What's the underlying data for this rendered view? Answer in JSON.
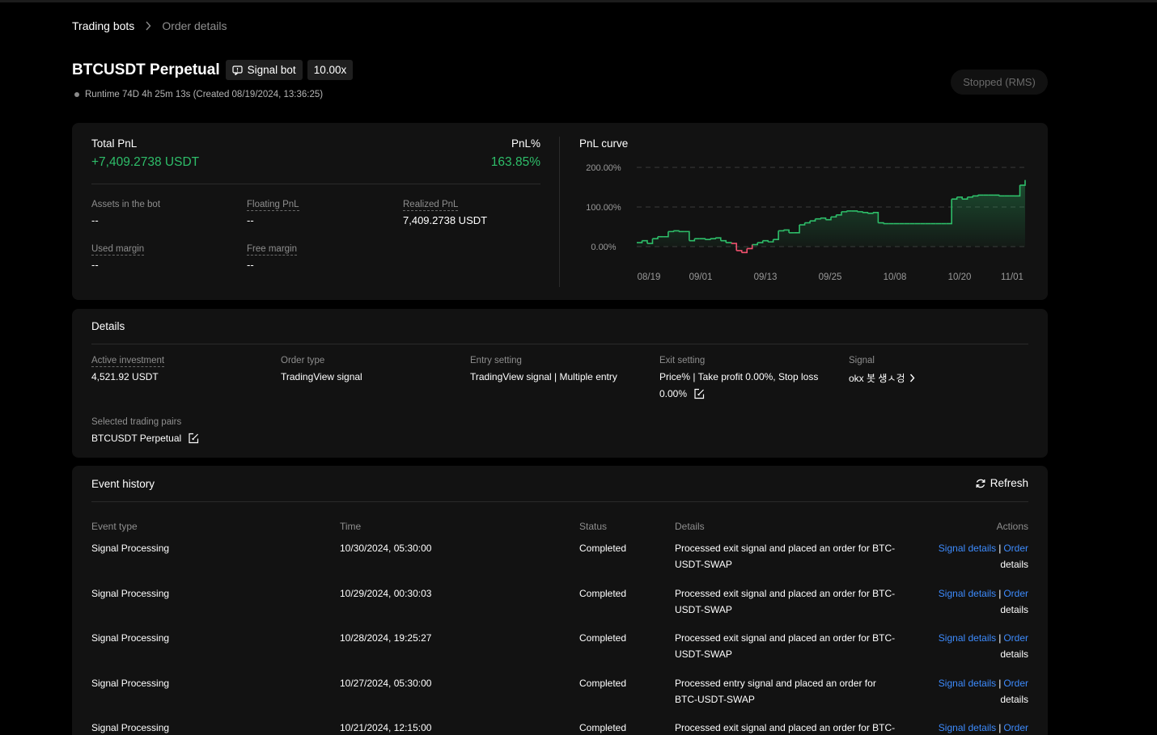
{
  "breadcrumb": {
    "root": "Trading bots",
    "current": "Order details"
  },
  "header": {
    "title": "BTCUSDT Perpetual",
    "bot_type": "Signal bot",
    "leverage": "10.00x",
    "runtime": "Runtime 74D 4h 25m 13s (Created 08/19/2024, 13:36:25)",
    "status": "Stopped (RMS)"
  },
  "summary": {
    "total_pnl_label": "Total PnL",
    "total_pnl_value": "+7,409.2738 USDT",
    "pnl_pct_label": "PnL%",
    "pnl_pct_value": "163.85%",
    "assets_label": "Assets in the bot",
    "assets_value": "--",
    "floating_label": "Floating PnL",
    "floating_value": "--",
    "realized_label": "Realized PnL",
    "realized_value": "7,409.2738 USDT",
    "used_margin_label": "Used margin",
    "used_margin_value": "--",
    "free_margin_label": "Free margin",
    "free_margin_value": "--"
  },
  "chart_data": {
    "type": "area",
    "title": "PnL curve",
    "xlabel": "",
    "ylabel": "",
    "yticks": [
      "200.00%",
      "100.00%",
      "0.00%"
    ],
    "xticks": [
      "08/19",
      "09/01",
      "09/13",
      "09/25",
      "10/08",
      "10/20",
      "11/01"
    ],
    "ylim": [
      0,
      200
    ],
    "grid": true,
    "colors": {
      "positive": "#2ebd69",
      "negative": "#f0506e"
    },
    "x": [
      "08/19",
      "08/20",
      "08/21",
      "08/22",
      "08/23",
      "08/24",
      "08/25",
      "08/26",
      "08/27",
      "08/28",
      "08/29",
      "08/30",
      "08/31",
      "09/01",
      "09/02",
      "09/03",
      "09/04",
      "09/05",
      "09/06",
      "09/07",
      "09/08",
      "09/09",
      "09/10",
      "09/11",
      "09/12",
      "09/13",
      "09/14",
      "09/15",
      "09/16",
      "09/17",
      "09/18",
      "09/19",
      "09/20",
      "09/21",
      "09/22",
      "09/23",
      "09/24",
      "09/25",
      "09/26",
      "09/27",
      "09/28",
      "09/29",
      "09/30",
      "10/01",
      "10/02",
      "10/03",
      "10/04",
      "10/05",
      "10/06",
      "10/07",
      "10/08",
      "10/09",
      "10/10",
      "10/11",
      "10/12",
      "10/13",
      "10/14",
      "10/15",
      "10/16",
      "10/17",
      "10/18",
      "10/19",
      "10/20",
      "10/21",
      "10/22",
      "10/23",
      "10/24",
      "10/25",
      "10/26",
      "10/27",
      "10/28",
      "10/29",
      "10/30",
      "10/31",
      "11/01"
    ],
    "values": [
      10,
      15,
      8,
      20,
      25,
      25,
      38,
      40,
      38,
      38,
      15,
      20,
      20,
      18,
      20,
      22,
      15,
      10,
      8,
      -10,
      -15,
      -5,
      5,
      10,
      15,
      12,
      18,
      40,
      42,
      35,
      35,
      55,
      60,
      65,
      70,
      72,
      68,
      75,
      80,
      88,
      90,
      90,
      88,
      86,
      84,
      86,
      60,
      58,
      58,
      58,
      58,
      58,
      58,
      58,
      58,
      58,
      58,
      58,
      58,
      58,
      120,
      125,
      120,
      125,
      128,
      130,
      130,
      130,
      130,
      128,
      128,
      128,
      128,
      155,
      168
    ]
  },
  "details": {
    "heading": "Details",
    "active_investment_label": "Active investment",
    "active_investment_value": "4,521.92 USDT",
    "order_type_label": "Order type",
    "order_type_value": "TradingView signal",
    "entry_label": "Entry setting",
    "entry_value": "TradingView signal | Multiple entry",
    "exit_label": "Exit setting",
    "exit_value_line1": "Price% | Take profit 0.00%, Stop loss",
    "exit_value_line2": "0.00%",
    "signal_label": "Signal",
    "signal_value": "okx 봇 생ㅅ겅",
    "pairs_label": "Selected trading pairs",
    "pairs_value": "BTCUSDT Perpetual"
  },
  "events": {
    "heading": "Event history",
    "refresh": "Refresh",
    "columns": {
      "type": "Event type",
      "time": "Time",
      "status": "Status",
      "details": "Details",
      "actions": "Actions"
    },
    "signal_details": "Signal details",
    "sep": "|",
    "order_word": "Order",
    "details_word": "details",
    "rows": [
      {
        "type": "Signal Processing",
        "time": "10/30/2024, 05:30:00",
        "status": "Completed",
        "d1": "Processed exit signal and placed an order for BTC-",
        "d2": "USDT-SWAP"
      },
      {
        "type": "Signal Processing",
        "time": "10/29/2024, 00:30:03",
        "status": "Completed",
        "d1": "Processed exit signal and placed an order for BTC-",
        "d2": "USDT-SWAP"
      },
      {
        "type": "Signal Processing",
        "time": "10/28/2024, 19:25:27",
        "status": "Completed",
        "d1": "Processed exit signal and placed an order for BTC-",
        "d2": "USDT-SWAP"
      },
      {
        "type": "Signal Processing",
        "time": "10/27/2024, 05:30:00",
        "status": "Completed",
        "d1": "Processed entry signal and placed an order for",
        "d2": "BTC-USDT-SWAP"
      },
      {
        "type": "Signal Processing",
        "time": "10/21/2024, 12:15:00",
        "status": "Completed",
        "d1": "Processed exit signal and placed an order for BTC-",
        "d2": ""
      }
    ]
  }
}
